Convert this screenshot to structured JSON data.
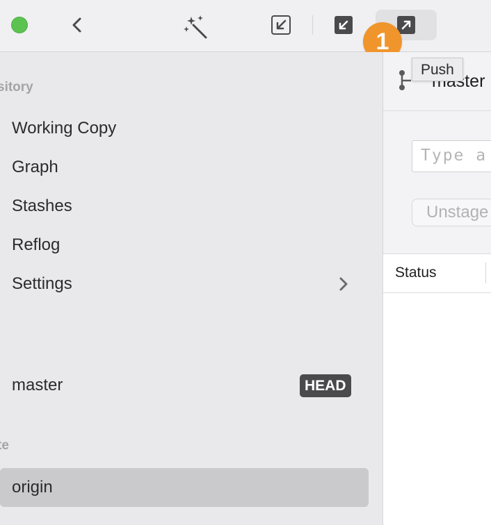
{
  "toolbar": {
    "push_tooltip": "Push",
    "badge_number": "1",
    "icons": [
      "back-chevron-icon",
      "magic-wand-icon",
      "pull-icon",
      "fetch-icon",
      "push-icon"
    ]
  },
  "sidebar": {
    "repository_header": "sitory",
    "nav_items": [
      {
        "label": "Working Copy"
      },
      {
        "label": "Graph"
      },
      {
        "label": "Stashes"
      },
      {
        "label": "Reflog"
      },
      {
        "label": "Settings"
      }
    ],
    "local_branch": {
      "name": "master",
      "badge": "HEAD"
    },
    "remote_header": "te",
    "remote_item": {
      "label": "origin",
      "selected": true
    }
  },
  "main": {
    "branch": "master",
    "commit_placeholder": "Type a",
    "unstage_label": "Unstage",
    "column_status": "Status"
  },
  "colors": {
    "badge": "#f0952c",
    "traffic_green": "#5cc350",
    "sidebar_bg": "#e9e9eb",
    "selected_bg": "#cacacc",
    "head_badge_bg": "#4a4a4c"
  }
}
